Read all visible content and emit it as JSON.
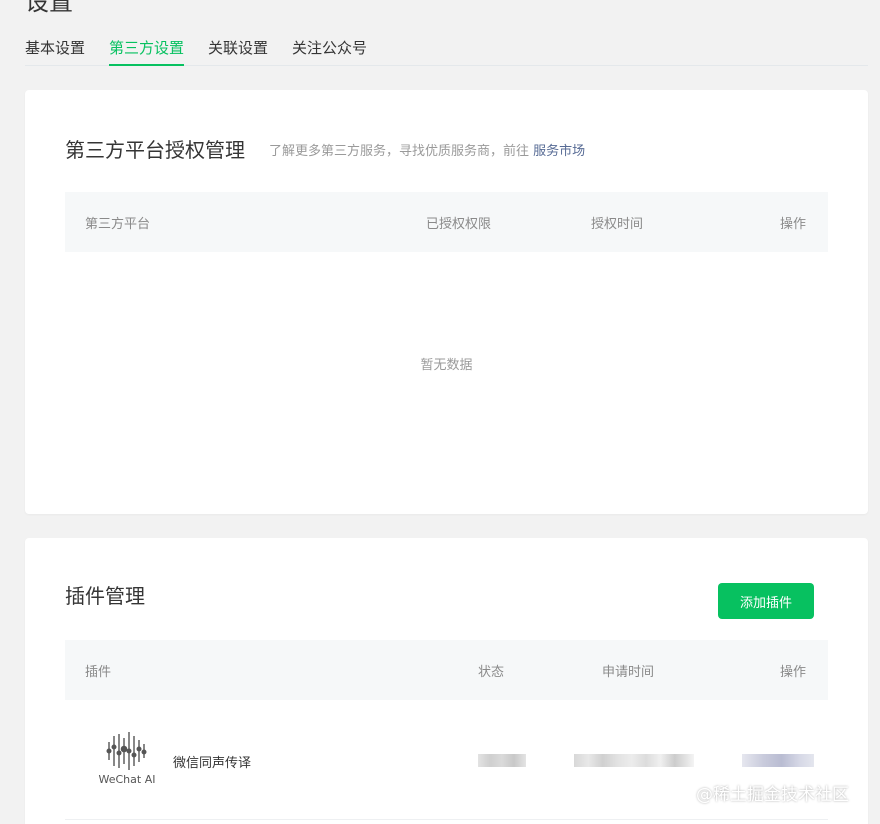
{
  "page": {
    "title": "设置"
  },
  "tabs": [
    {
      "label": "基本设置"
    },
    {
      "label": "第三方设置",
      "active": true
    },
    {
      "label": "关联设置"
    },
    {
      "label": "关注公众号"
    }
  ],
  "third_party": {
    "title": "第三方平台授权管理",
    "desc_prefix": "了解更多第三方服务，寻找优质服务商，前往",
    "desc_link": "服务市场",
    "columns": [
      "第三方平台",
      "已授权权限",
      "授权时间",
      "操作"
    ],
    "empty_text": "暂无数据"
  },
  "plugins": {
    "title": "插件管理",
    "add_button": "添加插件",
    "columns": [
      "插件",
      "状态",
      "申请时间",
      "操作"
    ],
    "rows": [
      {
        "logo_text": "WeChat AI",
        "name": "微信同声传译"
      }
    ]
  },
  "watermark": "@稀土掘金技术社区",
  "colors": {
    "accent": "#07c160",
    "link": "#576b95"
  }
}
